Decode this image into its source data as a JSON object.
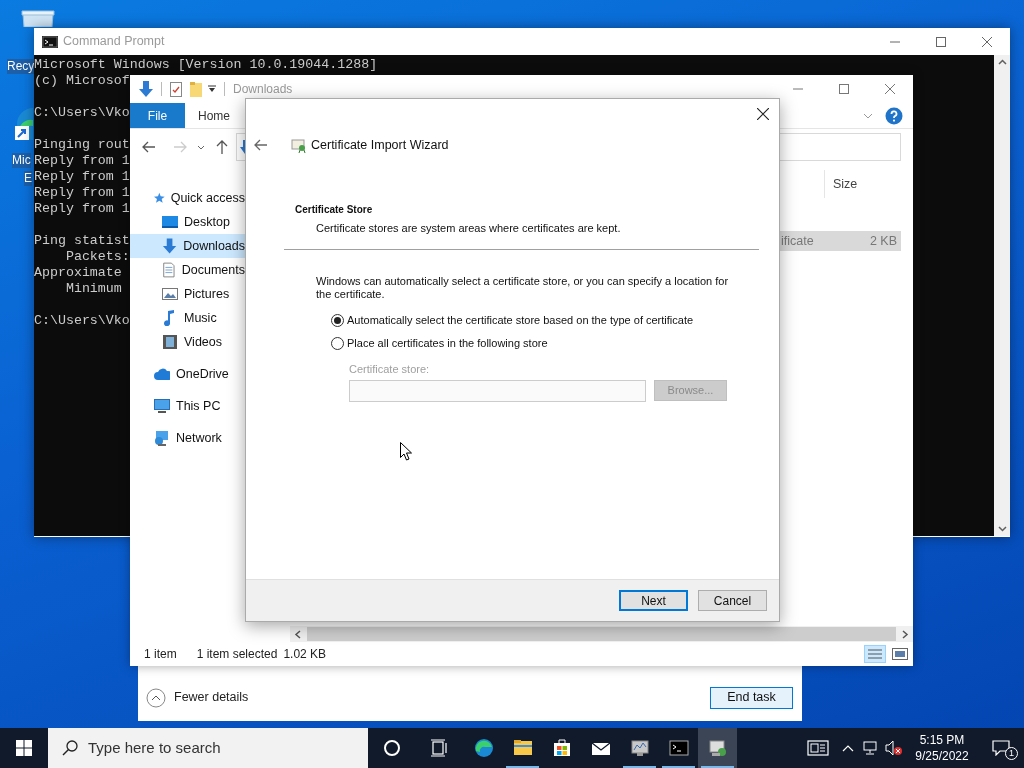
{
  "desktop": {
    "icons": [
      {
        "kind": "recycle_bin",
        "label_lines": [
          "Recy"
        ]
      },
      {
        "kind": "edge",
        "label_lines": [
          "Mic",
          "E"
        ]
      }
    ]
  },
  "cmd_window": {
    "title": "Command Prompt",
    "blocks": [
      [
        "Microsoft Windows [Version 10.0.19044.1288]",
        "(c) Microsof"
      ],
      [
        "C:\\Users\\Vko"
      ],
      [
        "Pinging rout",
        "Reply from 1",
        "Reply from 1",
        "Reply from 1",
        "Reply from 1"
      ],
      [
        "Ping statist",
        "    Packets:",
        "Approximate",
        "    Minimum"
      ],
      [
        "C:\\Users\\Vko"
      ]
    ]
  },
  "explorer": {
    "title": "Downloads",
    "ribbon_tabs": [
      {
        "label": "File",
        "kind": "file_menu"
      },
      {
        "label": "Home",
        "kind": "tab"
      }
    ],
    "nav": [
      {
        "label": "Quick access",
        "kind": "star",
        "selected": false,
        "children": [
          {
            "label": "Desktop",
            "kind": "desktop",
            "selected": false
          },
          {
            "label": "Downloads",
            "kind": "download",
            "selected": true
          },
          {
            "label": "Documents",
            "kind": "document",
            "selected": false
          },
          {
            "label": "Pictures",
            "kind": "pictures",
            "selected": false
          },
          {
            "label": "Music",
            "kind": "music",
            "selected": false
          },
          {
            "label": "Videos",
            "kind": "video",
            "selected": false
          }
        ]
      },
      {
        "label": "OneDrive",
        "kind": "cloud",
        "selected": false
      },
      {
        "label": "This PC",
        "kind": "pc",
        "selected": false
      },
      {
        "label": "Network",
        "kind": "network",
        "selected": false
      }
    ],
    "columns": [
      "Size"
    ],
    "files": [
      {
        "name": "ificate",
        "size": "2 KB",
        "selected": true
      }
    ],
    "status": [
      "1 item",
      "1 item selected",
      "1.02 KB"
    ]
  },
  "task_manager": {
    "details_toggle": "Fewer details",
    "end_task": "End task"
  },
  "dialog": {
    "title": "Certificate Import Wizard",
    "heading": "Certificate Store",
    "subheading": "Certificate stores are system areas where certificates are kept.",
    "intro": "Windows can automatically select a certificate store, or you can specify a location for the certificate.",
    "options": [
      {
        "label": "Automatically select the certificate store based on the type of certificate",
        "selected": true
      },
      {
        "label": "Place all certificates in the following store",
        "selected": false
      }
    ],
    "store_label": "Certificate store:",
    "store_disabled": true,
    "browse": "Browse...",
    "buttons": [
      {
        "label": "Next",
        "default": true
      },
      {
        "label": "Cancel",
        "default": false
      }
    ]
  },
  "taskbar": {
    "search_placeholder": "Type here to search",
    "apps": [
      {
        "kind": "cortana",
        "running": false,
        "active": false
      },
      {
        "kind": "taskview",
        "running": false,
        "active": false
      },
      {
        "kind": "edge",
        "running": false,
        "active": false
      },
      {
        "kind": "explorer",
        "running": true,
        "active": false
      },
      {
        "kind": "store",
        "running": false,
        "active": false
      },
      {
        "kind": "mail",
        "running": false,
        "active": false
      },
      {
        "kind": "monitor",
        "running": true,
        "active": false
      },
      {
        "kind": "cmd",
        "running": true,
        "active": false
      },
      {
        "kind": "certmgr",
        "running": true,
        "active": true
      }
    ],
    "time": "5:15 PM",
    "date": "9/25/2022",
    "notifications": "1"
  }
}
